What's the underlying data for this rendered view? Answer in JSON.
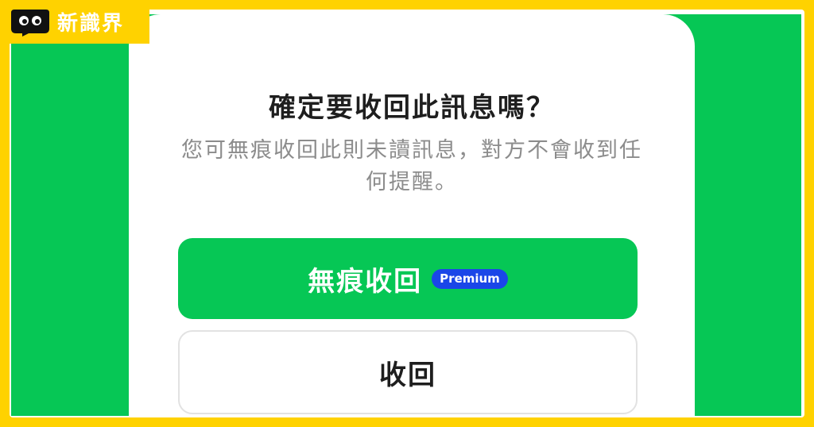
{
  "brand": {
    "name": "新識界"
  },
  "dialog": {
    "title": "確定要收回此訊息嗎？",
    "description": "您可無痕收回此則未讀訊息，對方不會收到任何提醒。",
    "primary_button": {
      "label": "無痕收回",
      "badge": "Premium"
    },
    "secondary_button": {
      "label": "收回"
    }
  },
  "colors": {
    "frame": "#FFD200",
    "background_green": "#06C755",
    "primary_button": "#06C755",
    "badge": "#1A46E8",
    "title_text": "#1E1E1E",
    "description_text": "#8C8C8C"
  }
}
